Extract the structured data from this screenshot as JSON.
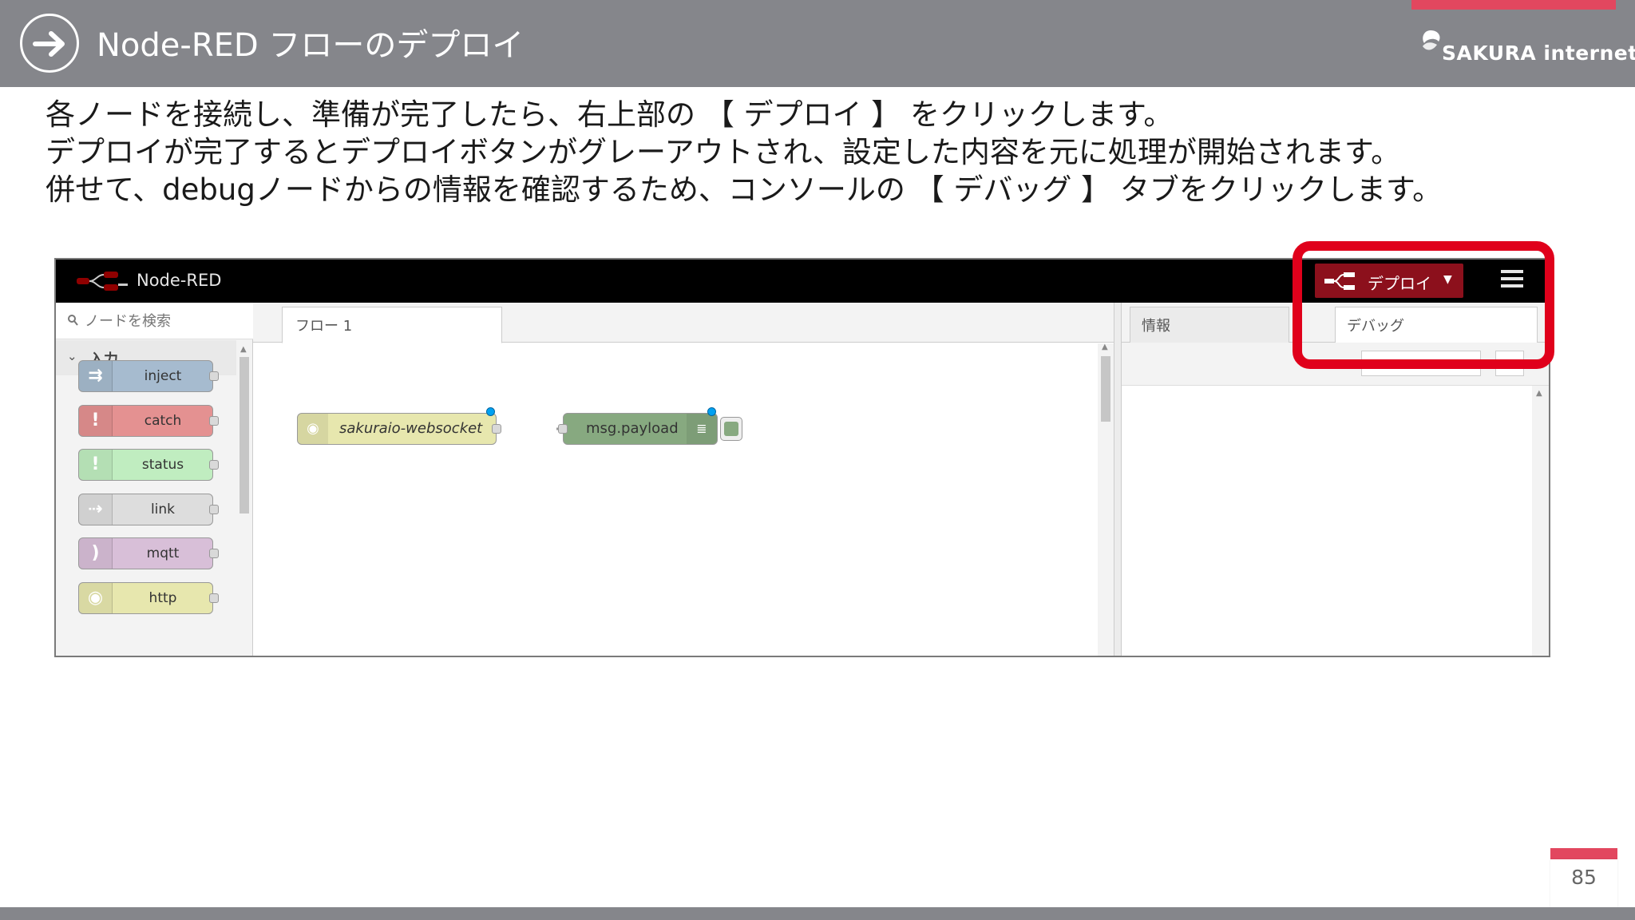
{
  "slide": {
    "title": "Node-RED フローのデプロイ",
    "brand": "SAKURA internet",
    "page_number": "85",
    "accent_color": "#e2475f",
    "header_color": "#85868b",
    "instructions": [
      "各ノードを接続し、準備が完了したら、右上部の 【 デプロイ 】 をクリックします。",
      "デプロイが完了するとデプロイボタンがグレーアウトされ、設定した内容を元に処理が開始されます。",
      "併せて、debugノードからの情報を確認するため、コンソールの 【 デバッグ 】 タブをクリックします。"
    ]
  },
  "nodered": {
    "app_title": "Node-RED",
    "deploy_label": "デプロイ",
    "deploy_color": "#8c101c",
    "menu_icon": "hamburger-icon",
    "search_placeholder": "ノードを検索",
    "category_label": "入力",
    "palette_nodes": [
      {
        "label": "inject",
        "color": "#a6bbcf",
        "icon": "arrow-icon"
      },
      {
        "label": "catch",
        "color": "#e49191",
        "icon": "exclamation-icon"
      },
      {
        "label": "status",
        "color": "#c0edc0",
        "icon": "exclamation-icon"
      },
      {
        "label": "link",
        "color": "#dddddd",
        "icon": "link-icon"
      },
      {
        "label": "mqtt",
        "color": "#d8bfd8",
        "icon": "bridge-icon"
      },
      {
        "label": "http",
        "color": "#e7e7ae",
        "icon": "globe-icon"
      }
    ],
    "flow_tab_label": "フロー 1",
    "add_tab_label": "+",
    "flow_nodes": [
      {
        "label": "sakuraio-websocket",
        "color": "#e7e7ae",
        "icon": "globe-icon"
      },
      {
        "label": "msg.payload",
        "color": "#87a980",
        "icon": "list-icon"
      }
    ],
    "sidebar_tabs": [
      "情報",
      "デバッグ"
    ],
    "highlight_color": "#e0001b"
  }
}
